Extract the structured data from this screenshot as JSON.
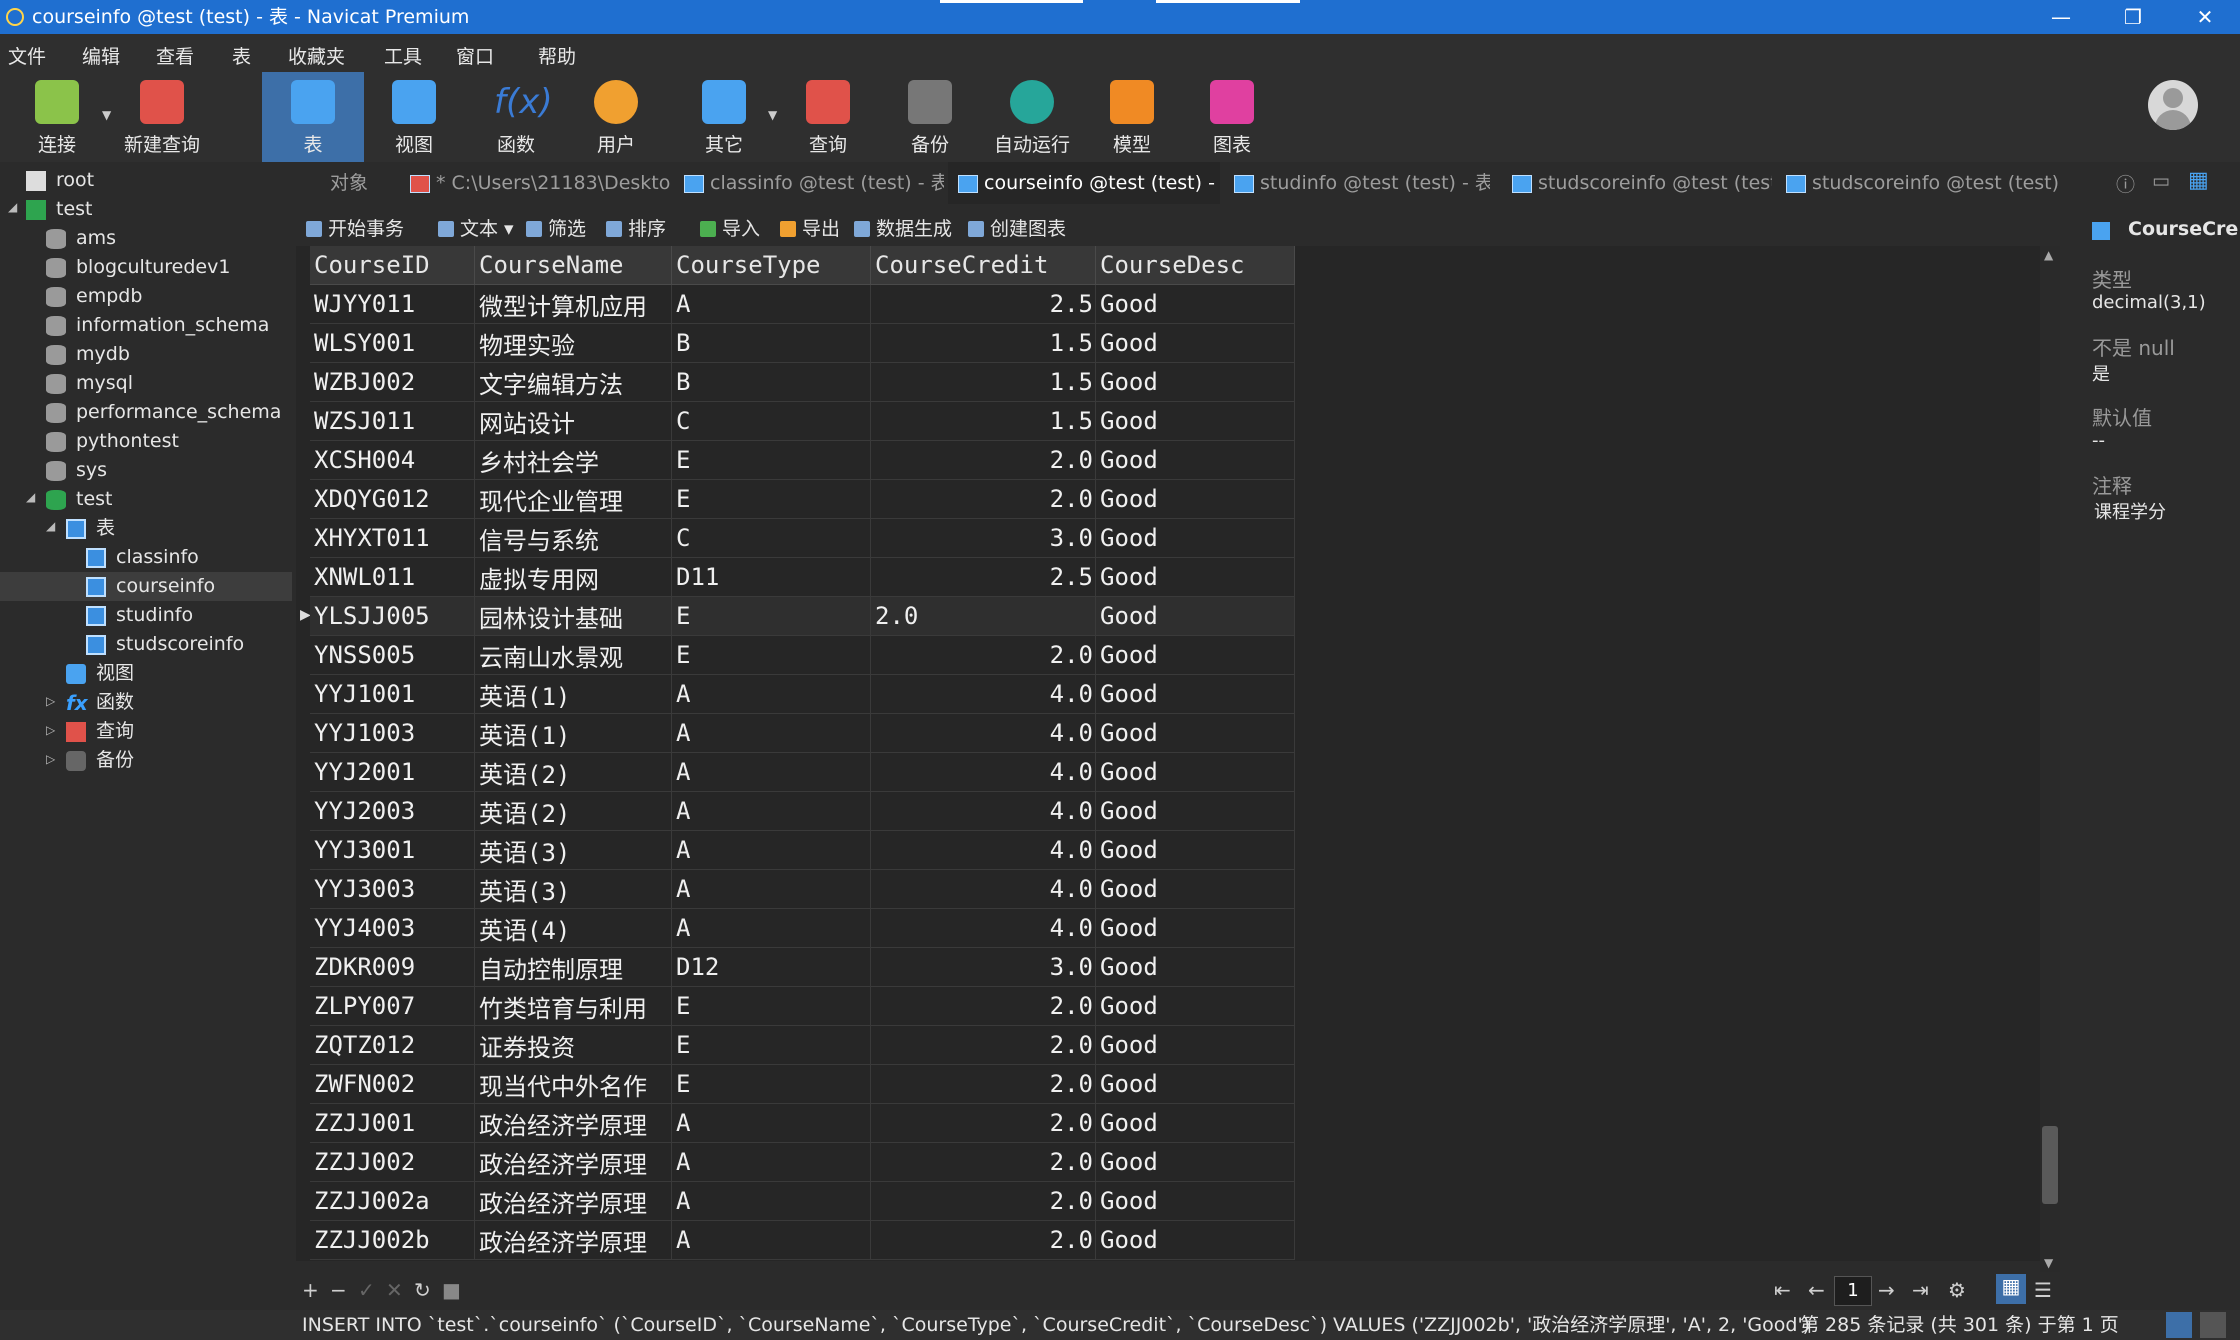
{
  "window": {
    "title": "courseinfo @test (test) - 表 - Navicat Premium",
    "controls": [
      "—",
      "❐",
      "✕"
    ]
  },
  "menu": [
    "文件",
    "编辑",
    "查看",
    "表",
    "收藏夹",
    "工具",
    "窗口",
    "帮助"
  ],
  "toolbar": [
    {
      "label": "连接",
      "icon": "connection-icon",
      "color": "#8bc34a"
    },
    {
      "label": "新建查询",
      "icon": "new-query-icon",
      "color": "#e0524a"
    },
    {
      "label": "表",
      "icon": "table-icon",
      "color": "#4aa3f0"
    },
    {
      "label": "视图",
      "icon": "view-icon",
      "color": "#4aa3f0"
    },
    {
      "label": "函数",
      "icon": "function-icon",
      "color": "#3a7bd5"
    },
    {
      "label": "用户",
      "icon": "user-icon",
      "color": "#f0a030"
    },
    {
      "label": "其它",
      "icon": "tools-icon",
      "color": "#4aa3f0"
    },
    {
      "label": "查询",
      "icon": "query-icon",
      "color": "#e0524a"
    },
    {
      "label": "备份",
      "icon": "backup-icon",
      "color": "#777777"
    },
    {
      "label": "自动运行",
      "icon": "robot-icon",
      "color": "#26a69a"
    },
    {
      "label": "模型",
      "icon": "model-icon",
      "color": "#f08a24"
    },
    {
      "label": "图表",
      "icon": "chart-icon",
      "color": "#e040a0"
    }
  ],
  "sidebar": {
    "root": "root",
    "test_conn": "test",
    "databases": [
      "ams",
      "blogculturedev1",
      "empdb",
      "information_schema",
      "mydb",
      "mysql",
      "performance_schema",
      "pythontest",
      "sys"
    ],
    "open_db": "test",
    "tables_folder": "表",
    "tables": [
      "classinfo",
      "courseinfo",
      "studinfo",
      "studscoreinfo"
    ],
    "views": "视图",
    "functions": "函数",
    "queries": "查询",
    "backups": "备份"
  },
  "tabs": [
    {
      "label": "对象"
    },
    {
      "label": "* C:\\Users\\21183\\Desktop..."
    },
    {
      "label": "classinfo @test (test) - 表"
    },
    {
      "label": "courseinfo @test (test) - 表"
    },
    {
      "label": "studinfo @test (test) - 表"
    },
    {
      "label": "studscoreinfo @test (test)..."
    },
    {
      "label": "studscoreinfo @test (test)..."
    }
  ],
  "grid_tools": [
    "开始事务",
    "文本",
    "筛选",
    "排序",
    "导入",
    "导出",
    "数据生成",
    "创建图表"
  ],
  "grid": {
    "columns": [
      "CourseID",
      "CourseName",
      "CourseType",
      "CourseCredit",
      "CourseDesc"
    ],
    "rows": [
      [
        "WJYY011",
        "微型计算机应用",
        "A",
        "2.5",
        "Good"
      ],
      [
        "WLSY001",
        "物理实验",
        "B",
        "1.5",
        "Good"
      ],
      [
        "WZBJ002",
        "文字编辑方法",
        "B",
        "1.5",
        "Good"
      ],
      [
        "WZSJ011",
        "网站设计",
        "C",
        "1.5",
        "Good"
      ],
      [
        "XCSH004",
        "乡村社会学",
        "E",
        "2.0",
        "Good"
      ],
      [
        "XDQYG012",
        "现代企业管理",
        "E",
        "2.0",
        "Good"
      ],
      [
        "XHYXT011",
        "信号与系统",
        "C",
        "3.0",
        "Good"
      ],
      [
        "XNWL011",
        "虚拟专用网",
        "D11",
        "2.5",
        "Good"
      ],
      [
        "YLSJJ005",
        "园林设计基础",
        "E",
        "2.0",
        "Good"
      ],
      [
        "YNSS005",
        "云南山水景观",
        "E",
        "2.0",
        "Good"
      ],
      [
        "YYJ1001",
        "英语(1)",
        "A",
        "4.0",
        "Good"
      ],
      [
        "YYJ1003",
        "英语(1)",
        "A",
        "4.0",
        "Good"
      ],
      [
        "YYJ2001",
        "英语(2)",
        "A",
        "4.0",
        "Good"
      ],
      [
        "YYJ2003",
        "英语(2)",
        "A",
        "4.0",
        "Good"
      ],
      [
        "YYJ3001",
        "英语(3)",
        "A",
        "4.0",
        "Good"
      ],
      [
        "YYJ3003",
        "英语(3)",
        "A",
        "4.0",
        "Good"
      ],
      [
        "YYJ4003",
        "英语(4)",
        "A",
        "4.0",
        "Good"
      ],
      [
        "ZDKR009",
        "自动控制原理",
        "D12",
        "3.0",
        "Good"
      ],
      [
        "ZLPY007",
        "竹类培育与利用",
        "E",
        "2.0",
        "Good"
      ],
      [
        "ZQTZ012",
        "证券投资",
        "E",
        "2.0",
        "Good"
      ],
      [
        "ZWFN002",
        "现当代中外名作",
        "E",
        "2.0",
        "Good"
      ],
      [
        "ZZJJ001",
        "政治经济学原理",
        "A",
        "2.0",
        "Good"
      ],
      [
        "ZZJJ002",
        "政治经济学原理",
        "A",
        "2.0",
        "Good"
      ],
      [
        "ZZJJ002a",
        "政治经济学原理",
        "A",
        "2.0",
        "Good"
      ],
      [
        "ZZJJ002b",
        "政治经济学原理",
        "A",
        "2.0",
        "Good"
      ]
    ],
    "editing_row": 8
  },
  "right_panel": {
    "title": "CourseCre",
    "type_label": "类型",
    "type_value": "decimal(3,1)",
    "notnull_label": "不是 null",
    "notnull_value": "是",
    "default_label": "默认值",
    "default_value": "--",
    "comment_label": "注释",
    "comment_value": "课程学分"
  },
  "bottom_nav": {
    "page": "1"
  },
  "status": {
    "sql": "INSERT INTO `test`.`courseinfo` (`CourseID`, `CourseName`, `CourseType`, `CourseCredit`, `CourseDesc`) VALUES ('ZZJJ002b', '政治经济学原理', 'A', 2, 'Good')",
    "records": "第 285 条记录 (共 301 条) 于第 1 页"
  }
}
